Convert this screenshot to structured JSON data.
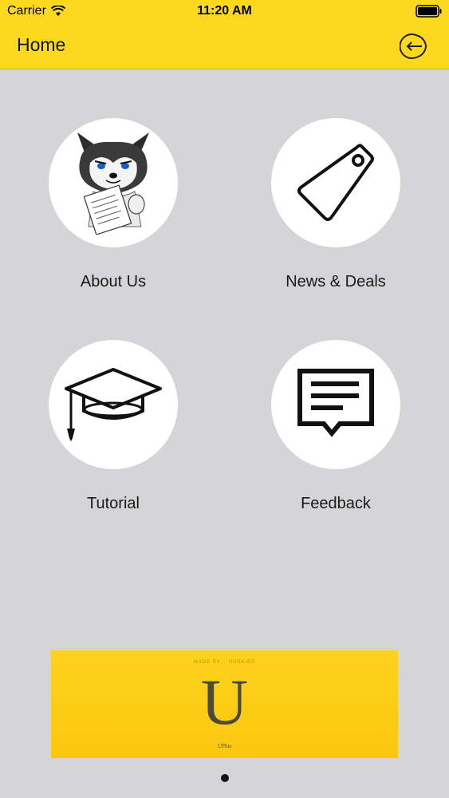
{
  "status_bar": {
    "carrier": "Carrier",
    "time": "11:20 AM"
  },
  "nav": {
    "title": "Home"
  },
  "tiles": [
    {
      "label": "About Us",
      "icon": "husky-mascot-icon"
    },
    {
      "label": "News & Deals",
      "icon": "tag-icon"
    },
    {
      "label": "Tutorial",
      "icon": "graduation-cap-icon"
    },
    {
      "label": "Feedback",
      "icon": "message-icon"
    }
  ],
  "banner": {
    "headline": "MADE BY... HUSKIES",
    "letter": "U",
    "caption": "UPlus"
  },
  "pager": {
    "pages": 1,
    "current": 1
  },
  "colors": {
    "accent": "#fcd91f",
    "background": "#d5d4d7"
  }
}
